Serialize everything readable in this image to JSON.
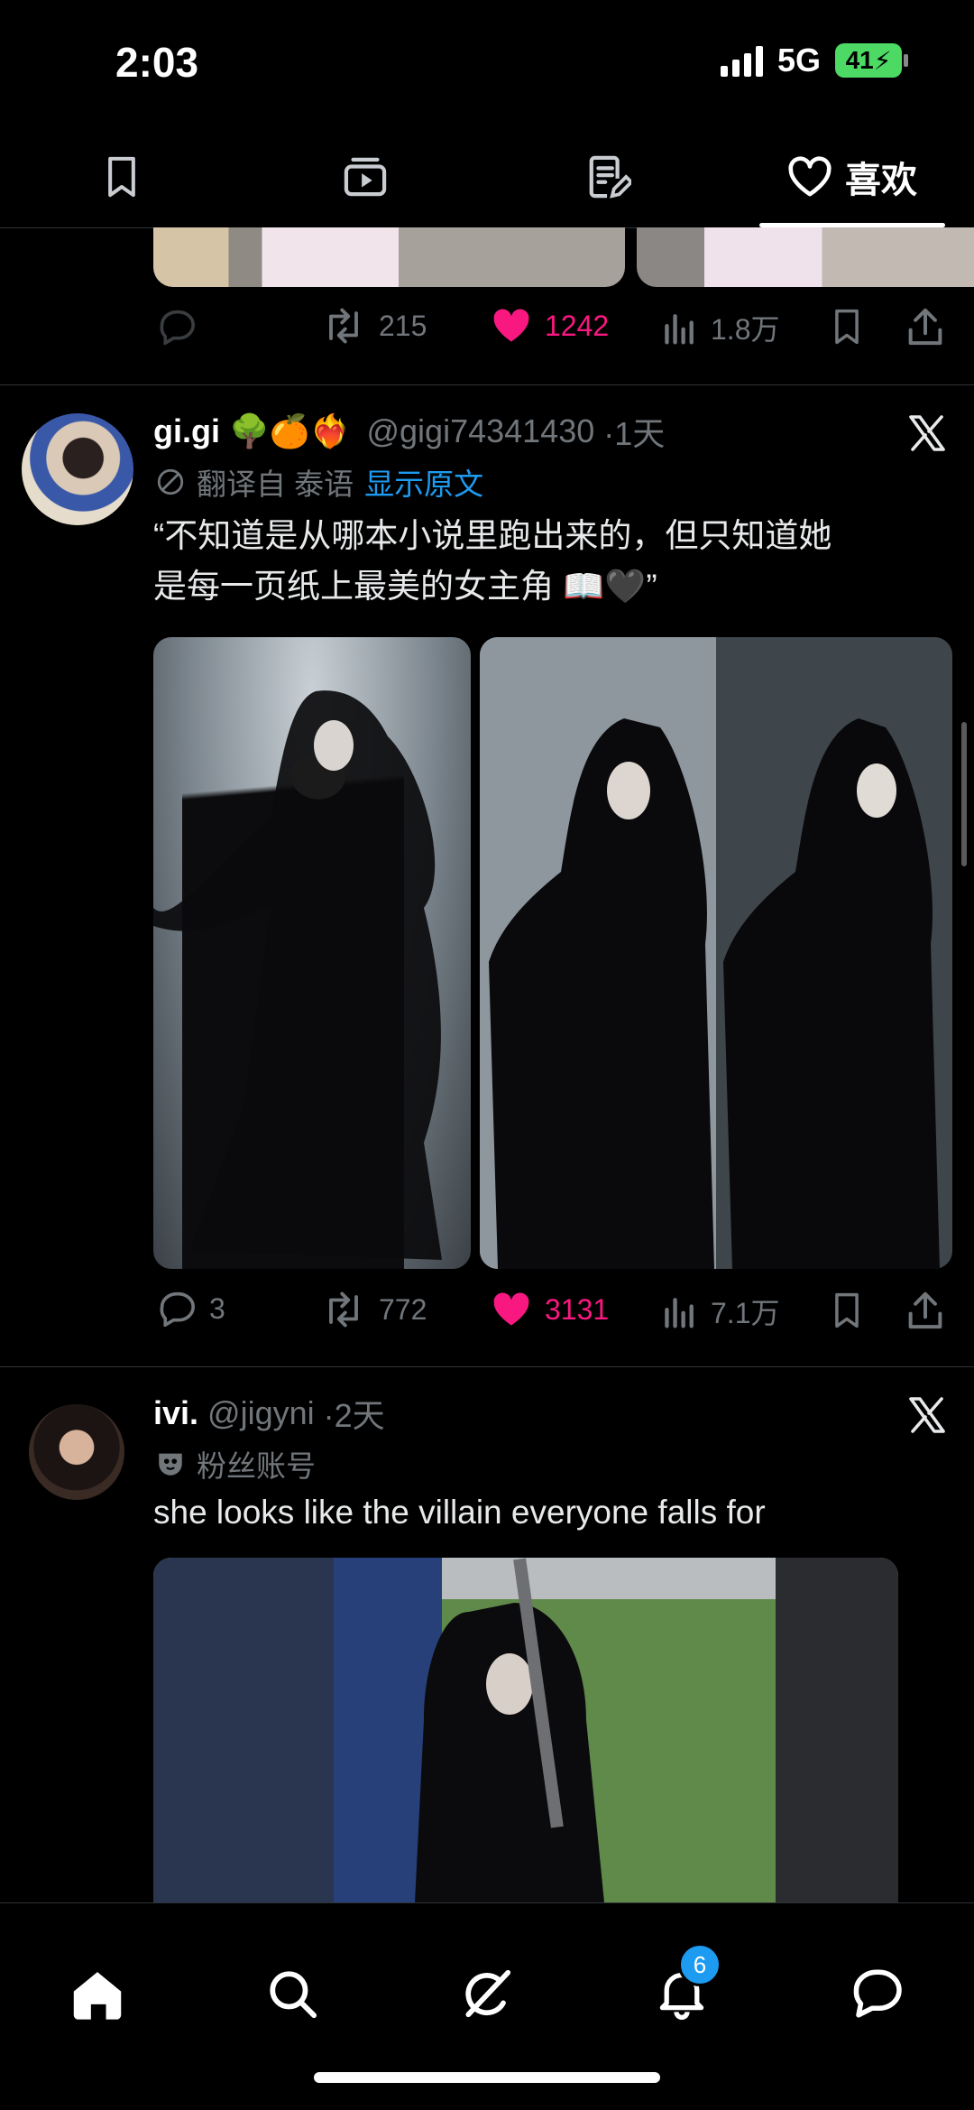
{
  "status_bar": {
    "time": "2:03",
    "network": "5G",
    "battery": "41"
  },
  "top_tabs": [
    {
      "name": "bookmarks",
      "icon": "bookmark-icon",
      "label": ""
    },
    {
      "name": "videos",
      "icon": "video-icon",
      "label": ""
    },
    {
      "name": "articles",
      "icon": "article-icon",
      "label": ""
    },
    {
      "name": "likes",
      "icon": "heart-outline-icon",
      "label": "喜欢",
      "active": true
    }
  ],
  "prev_tweet": {
    "retweets": "215",
    "likes": "1242",
    "views": "1.8万"
  },
  "tweet1": {
    "name": "gi.gi",
    "emoji": "🌳🍊❤️‍🔥",
    "handle": "@gigi74341430",
    "time": "·1天",
    "translated_label": "翻译自 泰语",
    "show_original": "显示原文",
    "text_line1": "“不知道是从哪本小说里跑出来的，但只知道她",
    "text_line2": "是每一页纸上最美的女主角 📖🖤”",
    "replies": "3",
    "retweets": "772",
    "likes": "3131",
    "views": "7.1万"
  },
  "tweet2": {
    "name": "ivi.",
    "handle": "@jigyni",
    "time": "·2天",
    "badge_label": "粉丝账号",
    "text": "she looks like the villain everyone falls for"
  },
  "bottom_nav": {
    "notifications_badge": "6",
    "items": [
      "home-icon",
      "search-icon",
      "grok-icon",
      "notifications-icon",
      "messages-icon"
    ]
  },
  "colors": {
    "like": "#f91880",
    "link": "#1d9bf0",
    "muted": "#71767b"
  }
}
